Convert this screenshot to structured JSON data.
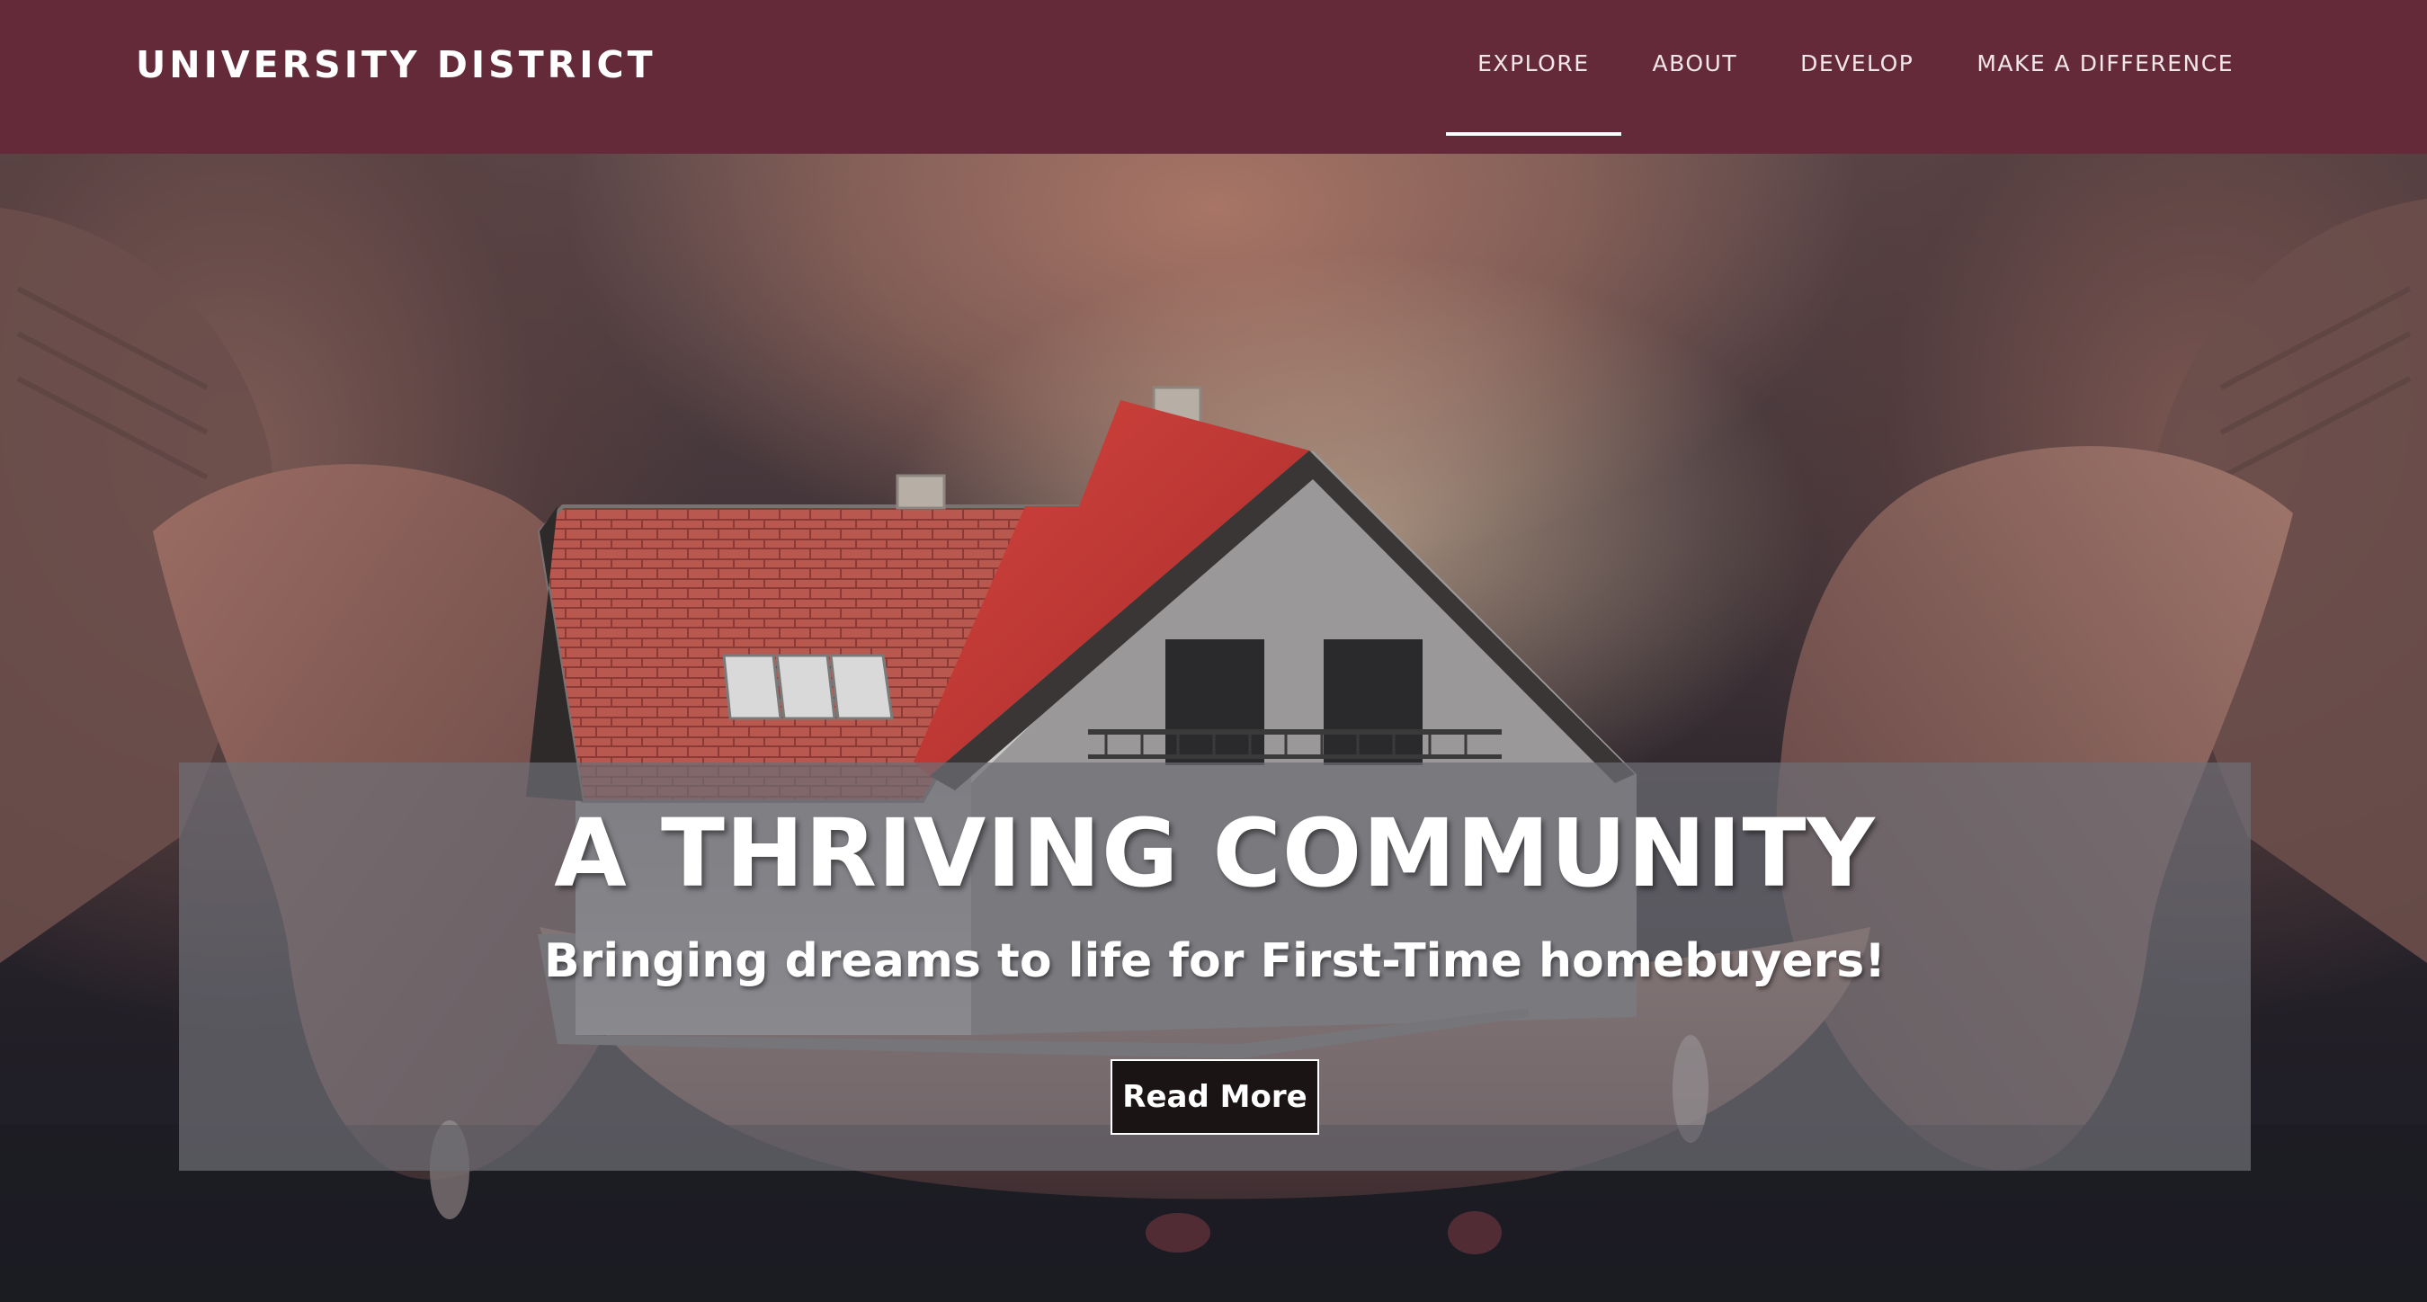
{
  "header": {
    "brand": "UNIVERSITY DISTRICT",
    "background_color": "#652a3a",
    "nav": [
      {
        "label": "EXPLORE",
        "active": true
      },
      {
        "label": "ABOUT",
        "active": false
      },
      {
        "label": "DEVELOP",
        "active": false
      },
      {
        "label": "MAKE A DIFFERENCE",
        "active": false
      }
    ]
  },
  "hero": {
    "image_subject": "hands-holding-house-model",
    "headline": "A THRIVING COMMUNITY",
    "subheadline": "Bringing dreams to life for First-Time homebuyers!",
    "cta_label": "Read More"
  }
}
